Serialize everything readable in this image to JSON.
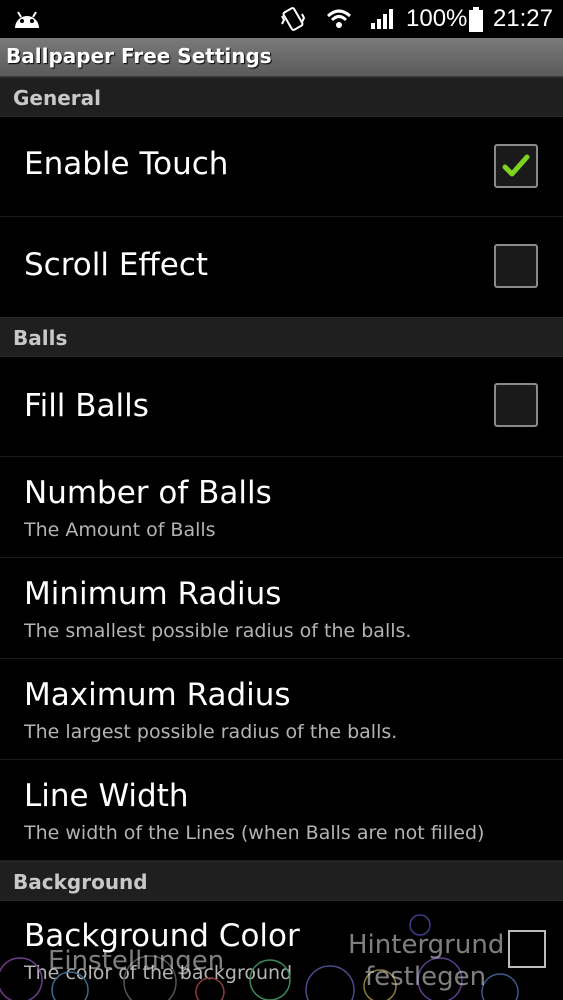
{
  "status_bar": {
    "battery_percent": "100%",
    "time": "21:27",
    "icons": [
      "android-icon",
      "vibrate-icon",
      "wifi-icon",
      "signal-icon",
      "battery-icon"
    ]
  },
  "title_bar": {
    "title": "Ballpaper Free Settings"
  },
  "sections": {
    "general": "General",
    "balls": "Balls",
    "background": "Background"
  },
  "prefs": {
    "enable_touch": {
      "title": "Enable Touch",
      "checked": true
    },
    "scroll_effect": {
      "title": "Scroll Effect",
      "checked": false
    },
    "fill_balls": {
      "title": "Fill Balls",
      "checked": false
    },
    "number_of_balls": {
      "title": "Number of Balls",
      "summary": "The Amount of Balls"
    },
    "minimum_radius": {
      "title": "Minimum Radius",
      "summary": "The smallest possible radius of the balls."
    },
    "maximum_radius": {
      "title": "Maximum Radius",
      "summary": "The largest possible radius of the balls."
    },
    "line_width": {
      "title": "Line Width",
      "summary": "The width of the Lines (when Balls are not filled)"
    },
    "background_color": {
      "title": "Background Color",
      "summary": "The color of the background"
    }
  },
  "overlay": {
    "settings_label": "Einstellungen",
    "set_background_line1": "Hintergrund",
    "set_background_line2": "festlegen"
  },
  "colors": {
    "checkmark": "#7ed321",
    "section_bg": "#1f1f1f",
    "title_bar_bg": "#6a6a6a"
  }
}
